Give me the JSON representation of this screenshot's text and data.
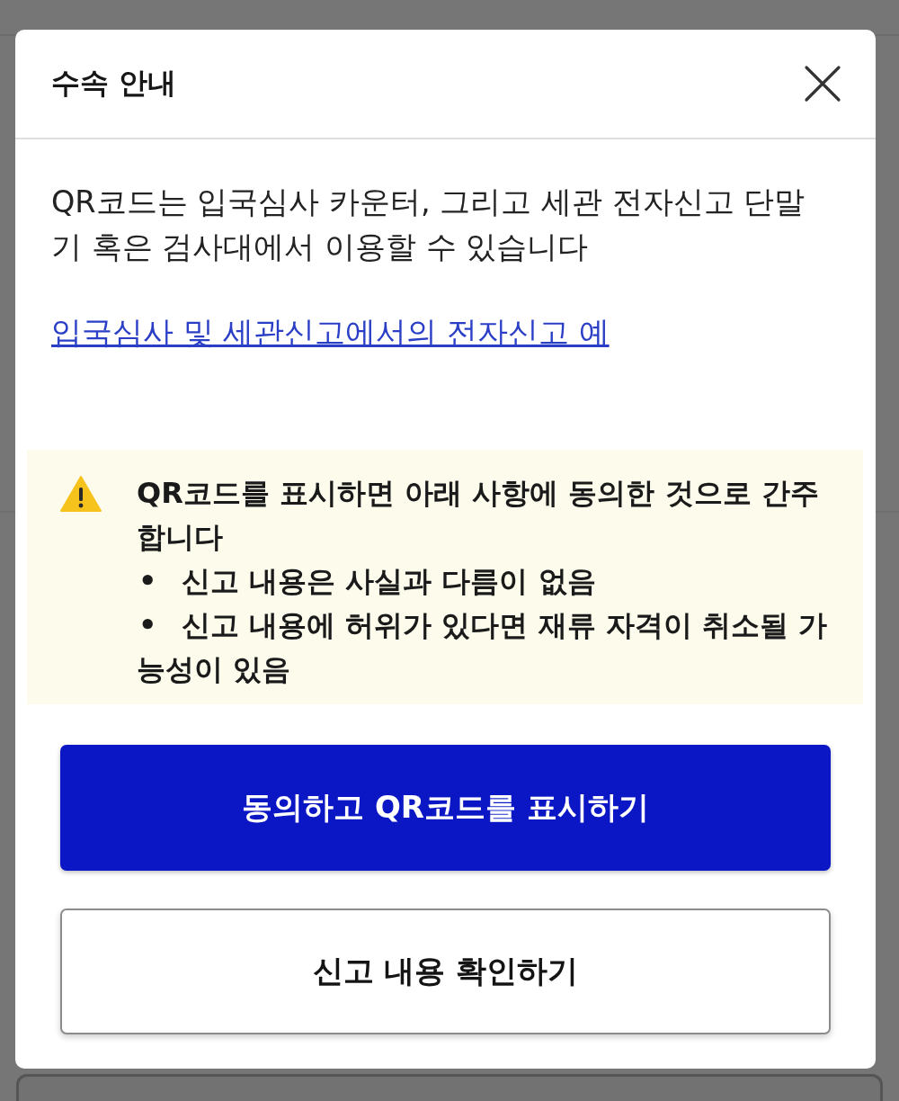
{
  "dialog": {
    "title": "수속 안내",
    "message": "QR코드는 입국심사 카운터, 그리고 세관 전자신고 단말기 혹은 검사대에서 이용할 수 있습니다",
    "link": "입국심사 및 세관신고에서의 전자신고 예",
    "notice": {
      "text": "QR코드를 표시하면 아래 사항에 동의한 것으로 간주합니다",
      "bullets": [
        {
          "marker": "•",
          "text": "신고 내용은 사실과 다름이 없음"
        },
        {
          "marker": "•",
          "text": "신고 내용에 허위가 있다면 재류 자격이 취소될 가능성이 있음"
        }
      ]
    },
    "buttons": [
      {
        "label": "동의하고 QR코드를 표시하기",
        "kind": "primary"
      },
      {
        "label": "신고 내용 확인하기",
        "kind": "secondary"
      }
    ]
  }
}
